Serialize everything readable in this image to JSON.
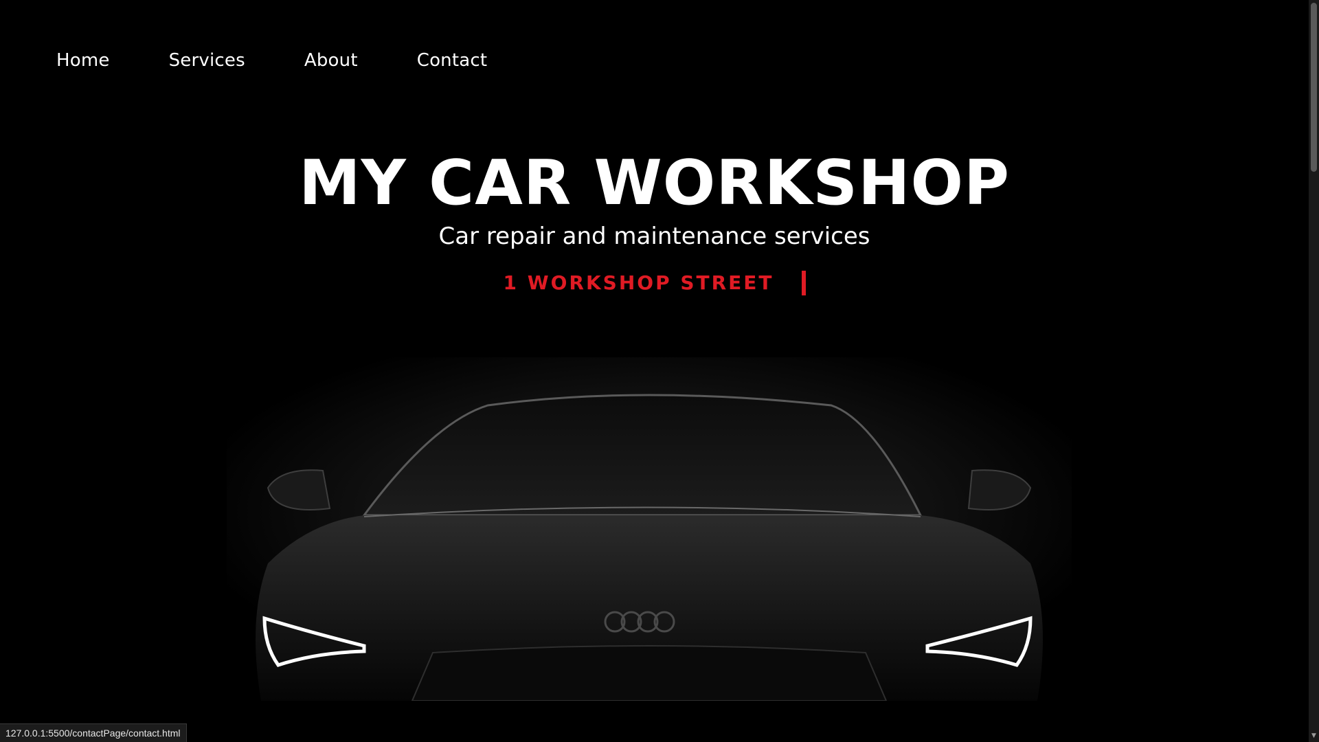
{
  "nav": {
    "items": [
      {
        "label": "Home"
      },
      {
        "label": "Services"
      },
      {
        "label": "About"
      },
      {
        "label": "Contact"
      }
    ]
  },
  "hero": {
    "title": "MY CAR WORKSHOP",
    "subtitle": "Car repair and maintenance services",
    "address": "1 WORKSHOP STREET"
  },
  "status_bar": {
    "url": "127.0.0.1:5500/contactPage/contact.html"
  },
  "colors": {
    "background": "#000000",
    "text": "#ffffff",
    "accent": "#e01b24"
  },
  "icons": {
    "scroll_down": "chevron-down-icon"
  }
}
